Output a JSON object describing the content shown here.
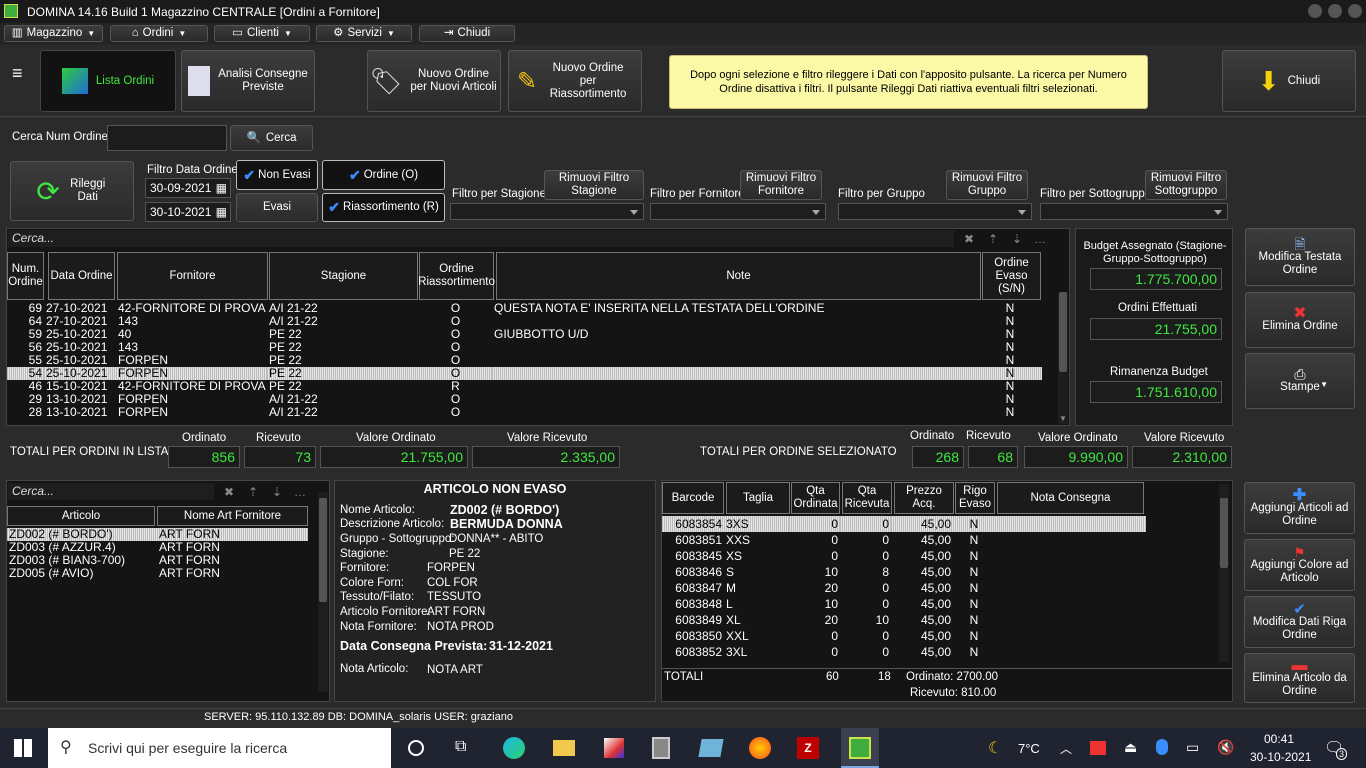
{
  "window": {
    "title": "DOMINA 14.16 Build 1  Magazzino CENTRALE [Ordini a Fornitore]"
  },
  "menu": [
    {
      "label": "Magazzino",
      "icon": "chart-icon"
    },
    {
      "label": "Ordini",
      "icon": "hierarchy-icon"
    },
    {
      "label": "Clienti",
      "icon": "card-icon"
    },
    {
      "label": "Servizi",
      "icon": "gear-icon"
    },
    {
      "label": "Chiudi",
      "icon": "exit-icon"
    }
  ],
  "toolbar": {
    "lista_ordini": "Lista Ordini",
    "analisi": "Analisi Consegne Previste",
    "nuovo_articoli": "Nuovo Ordine per Nuovi Articoli",
    "nuovo_riass": "Nuovo Ordine per Riassortimento",
    "info": "Dopo ogni selezione e filtro rileggere i Dati con l'apposito pulsante. La ricerca per Numero Ordine disattiva i filtri. Il pulsante Rileggi Dati riattiva eventuali filtri selezionati.",
    "chiudi": "Chiudi"
  },
  "search": {
    "label": "Cerca Num Ordine:",
    "value": "",
    "button": "Cerca"
  },
  "filters": {
    "rileggi": "Rileggi Dati",
    "filtro_data": "Filtro Data Ordine",
    "date_from": "30-09-2021",
    "date_to": "30-10-2021",
    "non_evasi": "Non Evasi",
    "evasi": "Evasi",
    "ordine": "Ordine (O)",
    "riass": "Riassortimento (R)",
    "stagione_label": "Filtro per Stagione",
    "rim_stagione": "Rimuovi Filtro Stagione",
    "fornitore_label": "Filtro per Fornitore",
    "rim_fornitore": "Rimuovi Filtro Fornitore",
    "gruppo_label": "Filtro per Gruppo",
    "rim_gruppo": "Rimuovi Filtro Gruppo",
    "sotto_label": "Filtro per Sottogruppo",
    "rim_sotto": "Rimuovi Filtro Sottogruppo"
  },
  "orders": {
    "search_placeholder": "Cerca...",
    "headers": [
      "Num. Ordine",
      "Data Ordine",
      "Fornitore",
      "Stagione",
      "Ordine Riassortimento",
      "Note",
      "Ordine Evaso (S/N)"
    ],
    "rows": [
      [
        "69",
        "27-10-2021",
        "42-FORNITORE DI PROVA",
        "A/I 21-22",
        "O",
        "QUESTA NOTA E' INSERITA NELLA TESTATA DELL'ORDINE",
        "N"
      ],
      [
        "64",
        "27-10-2021",
        "143",
        "A/I 21-22",
        "O",
        "",
        "N"
      ],
      [
        "59",
        "25-10-2021",
        "40",
        "PE 22",
        "O",
        "GIUBBOTTO U/D",
        "N"
      ],
      [
        "56",
        "25-10-2021",
        "143",
        "PE 22",
        "O",
        "",
        "N"
      ],
      [
        "55",
        "25-10-2021",
        "FORPEN",
        "PE 22",
        "O",
        "",
        "N"
      ],
      [
        "54",
        "25-10-2021",
        "FORPEN",
        "PE 22",
        "O",
        "",
        "N"
      ],
      [
        "46",
        "15-10-2021",
        "42-FORNITORE DI PROVA",
        "PE 22",
        "R",
        "",
        "N"
      ],
      [
        "29",
        "13-10-2021",
        "FORPEN",
        "A/I 21-22",
        "O",
        "",
        "N"
      ],
      [
        "28",
        "13-10-2021",
        "FORPEN",
        "A/I 21-22",
        "O",
        "",
        "N"
      ]
    ]
  },
  "budget": {
    "assegnato_label": "Budget Assegnato (Stagione-Gruppo-Sottogruppo)",
    "assegnato": "1.775.700,00",
    "effettuati_label": "Ordini Effettuati",
    "effettuati": "21.755,00",
    "rimanenza_label": "Rimanenza Budget",
    "rimanenza": "1.751.610,00"
  },
  "side": {
    "modifica": "Modifica Testata Ordine",
    "elimina": "Elimina Ordine",
    "stampe": "Stampe",
    "aggiungi_art": "Aggiungi Articoli ad Ordine",
    "aggiungi_col": "Aggiungi Colore ad Articolo",
    "modifica_riga": "Modifica Dati Riga Ordine",
    "elimina_art": "Elimina Articolo da Ordine"
  },
  "totals_list": {
    "label": "TOTALI PER ORDINI IN LISTA",
    "h_ord": "Ordinato",
    "h_ric": "Ricevuto",
    "h_vord": "Valore Ordinato",
    "h_vric": "Valore Ricevuto",
    "ord": "856",
    "ric": "73",
    "vord": "21.755,00",
    "vric": "2.335,00"
  },
  "totals_sel": {
    "label": "TOTALI PER ORDINE SELEZIONATO",
    "h_ord": "Ordinato",
    "h_ric": "Ricevuto",
    "h_vord": "Valore Ordinato",
    "h_vric": "Valore Ricevuto",
    "ord": "268",
    "ric": "68",
    "vord": "9.990,00",
    "vric": "2.310,00"
  },
  "articles": {
    "search_placeholder": "Cerca...",
    "headers": [
      "Articolo",
      "Nome Art Fornitore"
    ],
    "rows": [
      [
        "ZD002 (# BORDO')",
        "ART FORN"
      ],
      [
        "ZD003 (# AZZUR.4)",
        "ART FORN"
      ],
      [
        "ZD003 (# BIAN3-700)",
        "ART FORN"
      ],
      [
        "ZD005 (# AVIO)",
        "ART FORN"
      ]
    ]
  },
  "detail": {
    "title": "ARTICOLO NON EVASO",
    "nome_l": "Nome Articolo:",
    "nome": "ZD002 (# BORDO')",
    "desc_l": "Descrizione Articolo:",
    "desc": "BERMUDA DONNA",
    "fields": [
      [
        "Gruppo - Sottogruppo:",
        "DONNA** - ABITO"
      ],
      [
        "Stagione:",
        "PE 22"
      ],
      [
        "Fornitore:",
        "FORPEN"
      ],
      [
        "Colore Forn:",
        "COL FOR"
      ],
      [
        "Tessuto/Filato:",
        "TESSUTO"
      ],
      [
        "Articolo Fornitore:",
        "ART FORN"
      ],
      [
        "Nota Fornitore:",
        "NOTA PROD"
      ]
    ],
    "consegna_l": "Data Consegna Prevista:",
    "consegna": "31-12-2021",
    "nota_l": "Nota Articolo:",
    "nota": "NOTA ART"
  },
  "sizes": {
    "headers": [
      "Barcode",
      "Taglia",
      "Qta Ordinata",
      "Qta Ricevuta",
      "Prezzo Acq.",
      "Rigo Evaso",
      "Nota Consegna"
    ],
    "rows": [
      [
        "6083854",
        "3XS",
        "0",
        "0",
        "45,00",
        "N"
      ],
      [
        "6083851",
        "XXS",
        "0",
        "0",
        "45,00",
        "N"
      ],
      [
        "6083845",
        "XS",
        "0",
        "0",
        "45,00",
        "N"
      ],
      [
        "6083846",
        "S",
        "10",
        "8",
        "45,00",
        "N"
      ],
      [
        "6083847",
        "M",
        "20",
        "0",
        "45,00",
        "N"
      ],
      [
        "6083848",
        "L",
        "10",
        "0",
        "45,00",
        "N"
      ],
      [
        "6083849",
        "XL",
        "20",
        "10",
        "45,00",
        "N"
      ],
      [
        "6083850",
        "XXL",
        "0",
        "0",
        "45,00",
        "N"
      ],
      [
        "6083852",
        "3XL",
        "0",
        "0",
        "45,00",
        "N"
      ]
    ],
    "totali": "TOTALI",
    "tot_ord": "60",
    "tot_ric": "18",
    "ordinato": "Ordinato: 2700.00",
    "ricevuto": "Ricevuto: 810.00"
  },
  "status": "SERVER: 95.110.132.89 DB: DOMINA_solaris USER: graziano",
  "taskbar": {
    "search": "Scrivi qui per eseguire la ricerca",
    "temp": "7°C",
    "time": "00:41",
    "date": "30-10-2021",
    "notif": "3"
  }
}
